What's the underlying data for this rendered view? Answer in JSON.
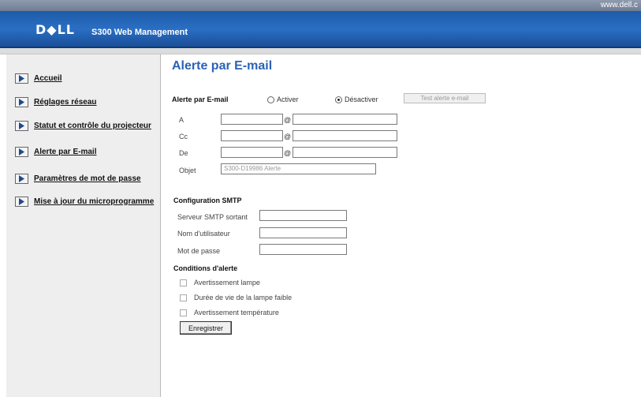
{
  "header": {
    "url": "www.dell.c",
    "logo": "D◆LL",
    "subtitle": "S300 Web Management"
  },
  "sidebar": {
    "items": [
      {
        "label": "Accueil"
      },
      {
        "label": "Réglages réseau"
      },
      {
        "label": "Statut et contrôle du projecteur"
      },
      {
        "label": "Alerte par E-mail"
      },
      {
        "label": "Paramètres de mot de passe"
      },
      {
        "label": "Mise à jour du microprogramme"
      }
    ]
  },
  "main": {
    "title": "Alerte par E-mail",
    "alert_label": "Alerte par E-mail",
    "radio_on": "Activer",
    "radio_off": "Désactiver",
    "test_button": "Test alerte e-mail",
    "to_label": "A",
    "cc_label": "Cc",
    "from_label": "De",
    "subject_label": "Objet",
    "subject_value": "S300-D19986  Alerte",
    "at": "@",
    "smtp_heading": "Configuration SMTP",
    "smtp_server_label": "Serveur SMTP sortant",
    "username_label": "Nom d'utilisateur",
    "password_label": "Mot de passe",
    "conditions_heading": "Conditions d'alerte",
    "cond_lamp": "Avertissement lampe",
    "cond_lamp_life": "Durée de vie de la lampe faible",
    "cond_temp": "Avertissement température",
    "save_button": "Enregistrer"
  }
}
